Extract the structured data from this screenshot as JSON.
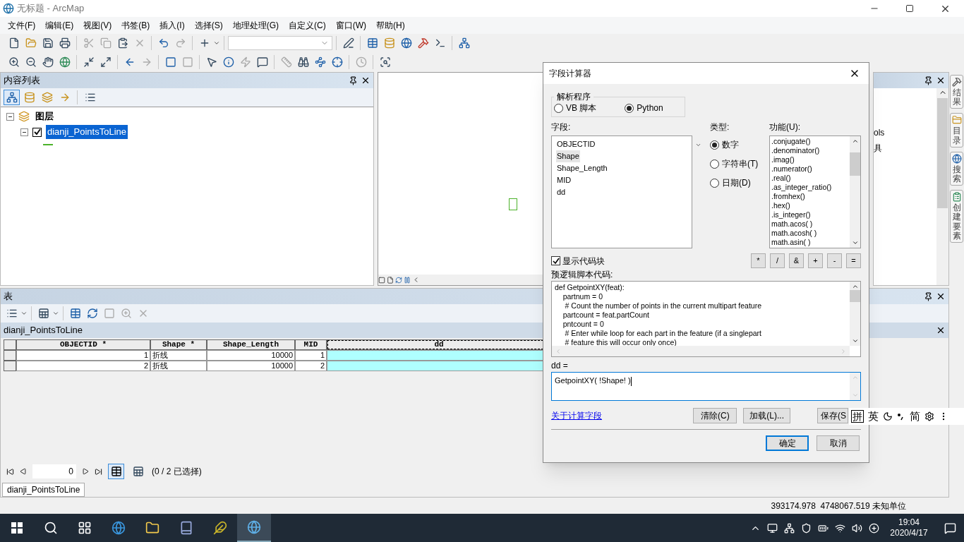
{
  "window": {
    "title": "无标题 - ArcMap"
  },
  "menu": [
    {
      "label": "文件(F)"
    },
    {
      "label": "编辑(E)"
    },
    {
      "label": "视图(V)"
    },
    {
      "label": "书签(B)"
    },
    {
      "label": "插入(I)"
    },
    {
      "label": "选择(S)"
    },
    {
      "label": "地理处理(G)"
    },
    {
      "label": "自定义(C)"
    },
    {
      "label": "窗口(W)"
    },
    {
      "label": "帮助(H)"
    }
  ],
  "toc": {
    "title": "内容列表",
    "tree": [
      {
        "kind": "group",
        "label": "图层",
        "expanded": true,
        "selected": false,
        "children": [
          {
            "kind": "layer",
            "label": "dianji_PointsToLine",
            "expanded": true,
            "checked": true,
            "selected": true
          }
        ]
      }
    ]
  },
  "right_panel": {
    "texts": [
      "ols",
      "具"
    ]
  },
  "side_tabs": [
    {
      "label": "结果"
    },
    {
      "label": "目录"
    },
    {
      "label": "搜索"
    },
    {
      "label": "创建要素"
    }
  ],
  "table": {
    "title": "表",
    "tab": "dianji_PointsToLine",
    "columns": [
      {
        "label": "OBJECTID *",
        "selected": false
      },
      {
        "label": "Shape *",
        "selected": false
      },
      {
        "label": "Shape_Length",
        "selected": false
      },
      {
        "label": "MID",
        "selected": false
      },
      {
        "label": "dd",
        "selected": true
      }
    ],
    "rows": [
      {
        "cells": [
          "1",
          "折线",
          "10000",
          "1",
          null
        ]
      },
      {
        "cells": [
          "2",
          "折线",
          "10000",
          "2",
          null
        ]
      }
    ],
    "record": "0",
    "selection": "(0 / 2 已选择)",
    "bottom_tab": "dianji_PointsToLine"
  },
  "status_bar": {
    "coords": "393174.978  4748067.519 未知单位"
  },
  "dialog": {
    "title": "字段计算器",
    "parser": {
      "label": "解析程序",
      "options": [
        {
          "label": "VB 脚本",
          "selected": false
        },
        {
          "label": "Python",
          "selected": true
        }
      ]
    },
    "fields_label": "字段:",
    "fields": [
      {
        "label": "OBJECTID",
        "selected": false
      },
      {
        "label": "Shape",
        "selected": true
      },
      {
        "label": "Shape_Length",
        "selected": false
      },
      {
        "label": "MID",
        "selected": false
      },
      {
        "label": "dd",
        "selected": false
      }
    ],
    "type_label": "类型:",
    "types": [
      {
        "label": "数字",
        "selected": true
      },
      {
        "label": "字符串(T)",
        "selected": false
      },
      {
        "label": "日期(D)",
        "selected": false
      }
    ],
    "functions_label": "功能(U):",
    "functions": [
      ".conjugate()",
      ".denominator()",
      ".imag()",
      ".numerator()",
      ".real()",
      ".as_integer_ratio()",
      ".fromhex()",
      ".hex()",
      ".is_integer()",
      "math.acos( )",
      "math.acosh( )",
      "math.asin( )"
    ],
    "show_code": {
      "label": "显示代码块",
      "checked": true
    },
    "operators": [
      "*",
      "/",
      "&",
      "+",
      "-",
      "="
    ],
    "code_label": "预逻辑脚本代码:",
    "code": [
      "def GetpointXY(feat):",
      "    partnum = 0",
      "     # Count the number of points in the current multipart feature",
      "    partcount = feat.partCount",
      "    pntcount = 0",
      "     # Enter while loop for each part in the feature (if a singlepart",
      "     # feature this will occur only once)"
    ],
    "expression_label": "dd =",
    "expression": "GetpointXY( !Shape! )",
    "link": "关于计算字段",
    "file_buttons": [
      "清除(C)",
      "加载(L)...",
      "保存(S"
    ],
    "ok": "确定",
    "cancel": "取消"
  },
  "ime": {
    "texts": [
      "拼",
      "英",
      "简"
    ]
  },
  "taskbar": {
    "time": "19:04",
    "date": "2020/4/17"
  }
}
